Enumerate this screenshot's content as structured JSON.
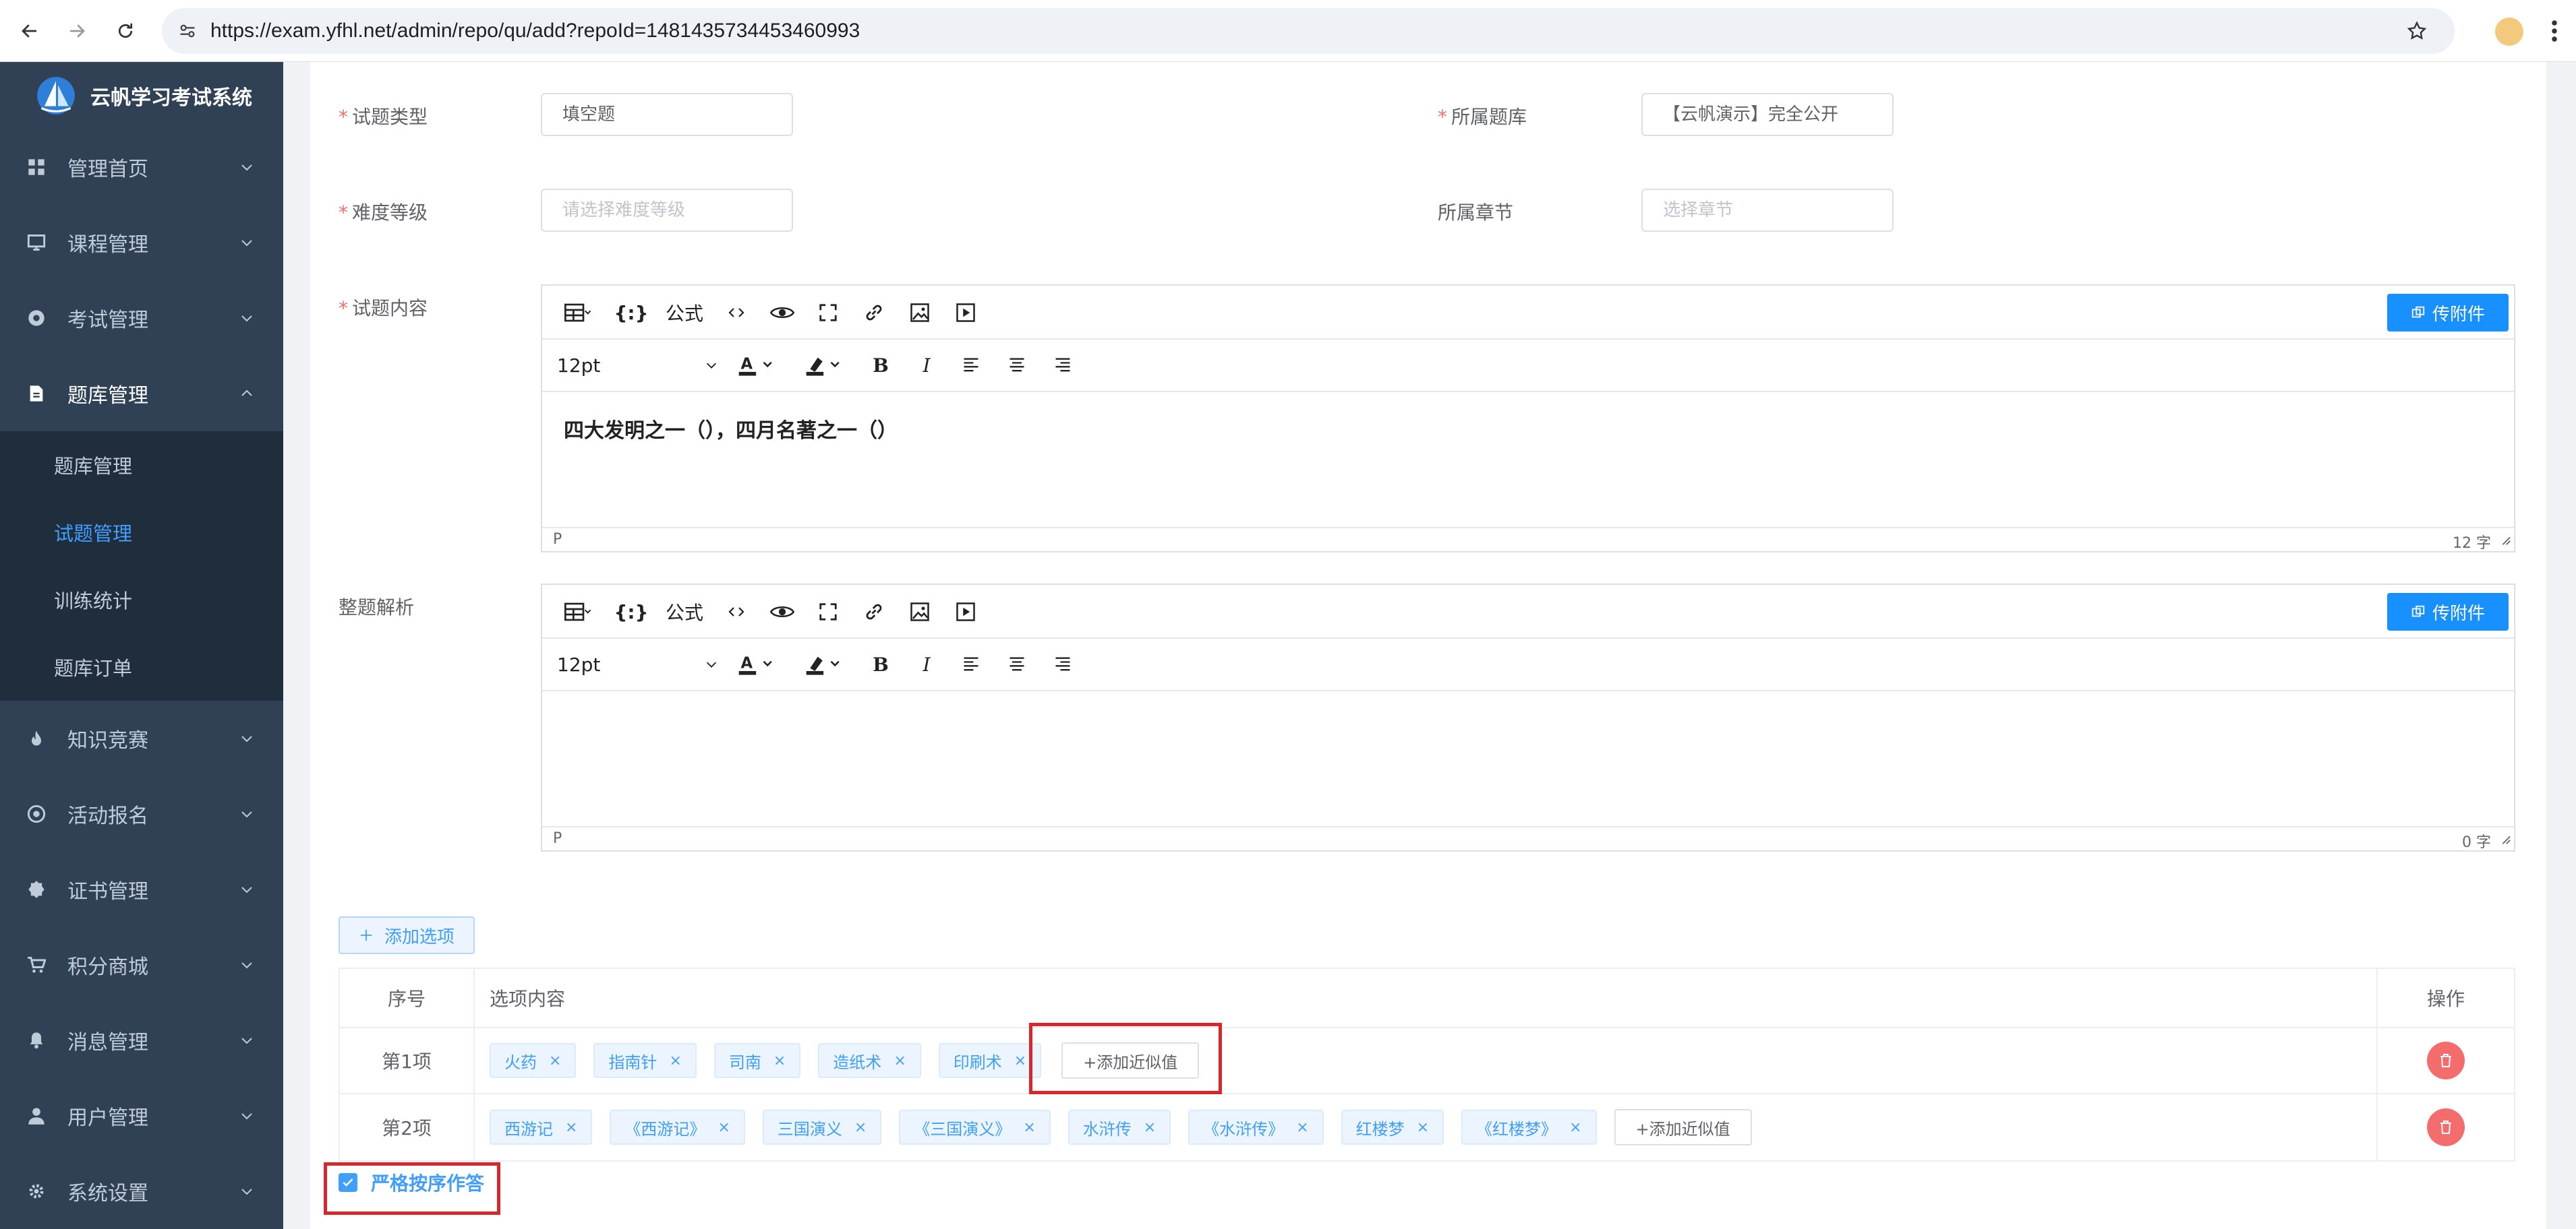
{
  "browser": {
    "url": "https://exam.yfhl.net/admin/repo/qu/add?repoId=1481435734453460993"
  },
  "sidebar": {
    "brand": "云帆学习考试系统",
    "items": [
      {
        "label": "管理首页",
        "icon": "dashboard-icon"
      },
      {
        "label": "课程管理",
        "icon": "monitor-icon"
      },
      {
        "label": "考试管理",
        "icon": "compass-icon"
      },
      {
        "label": "题库管理",
        "icon": "document-icon",
        "expanded": true
      }
    ],
    "subitems": [
      {
        "label": "题库管理",
        "active": false
      },
      {
        "label": "试题管理",
        "active": true
      },
      {
        "label": "训练统计",
        "active": false
      },
      {
        "label": "题库订单",
        "active": false
      }
    ],
    "items_after": [
      {
        "label": "知识竞赛",
        "icon": "fire-icon"
      },
      {
        "label": "活动报名",
        "icon": "target-icon"
      },
      {
        "label": "证书管理",
        "icon": "badge-icon"
      },
      {
        "label": "积分商城",
        "icon": "cart-icon"
      },
      {
        "label": "消息管理",
        "icon": "bell-icon"
      },
      {
        "label": "用户管理",
        "icon": "user-icon"
      },
      {
        "label": "系统设置",
        "icon": "gear-icon"
      }
    ]
  },
  "form": {
    "type_label": "试题类型",
    "type_value": "填空题",
    "repo_label": "所属题库",
    "repo_value": "【云帆演示】完全公开",
    "level_label": "难度等级",
    "level_placeholder": "请选择难度等级",
    "chapter_label": "所属章节",
    "chapter_placeholder": "选择章节",
    "content_label": "试题内容",
    "analysis_label": "整题解析"
  },
  "editor": {
    "formula": "公式",
    "font_size": "12pt",
    "upload": "传附件",
    "status_p": "P",
    "content": "四大发明之一（），四月名著之一（）",
    "content_wordcount": "12 字",
    "analysis_wordcount": "0 字"
  },
  "options": {
    "add_button": "添加选项",
    "col_no": "序号",
    "col_content": "选项内容",
    "col_op": "操作",
    "add_similar": "+添加近似值",
    "rows": [
      {
        "no": "第1项",
        "tags": [
          "火药",
          "指南针",
          "司南",
          "造纸术",
          "印刷术"
        ]
      },
      {
        "no": "第2项",
        "tags": [
          "西游记",
          "《西游记》",
          "三国演义",
          "《三国演义》",
          "水浒传",
          "《水浒传》",
          "红楼梦",
          "《红楼梦》"
        ]
      }
    ]
  },
  "strict_order": {
    "label": "严格按序作答",
    "checked": true
  },
  "colors": {
    "sidebar_bg": "#304156",
    "accent": "#409eff",
    "danger": "#f56c6c",
    "highlight": "#d9262b"
  }
}
